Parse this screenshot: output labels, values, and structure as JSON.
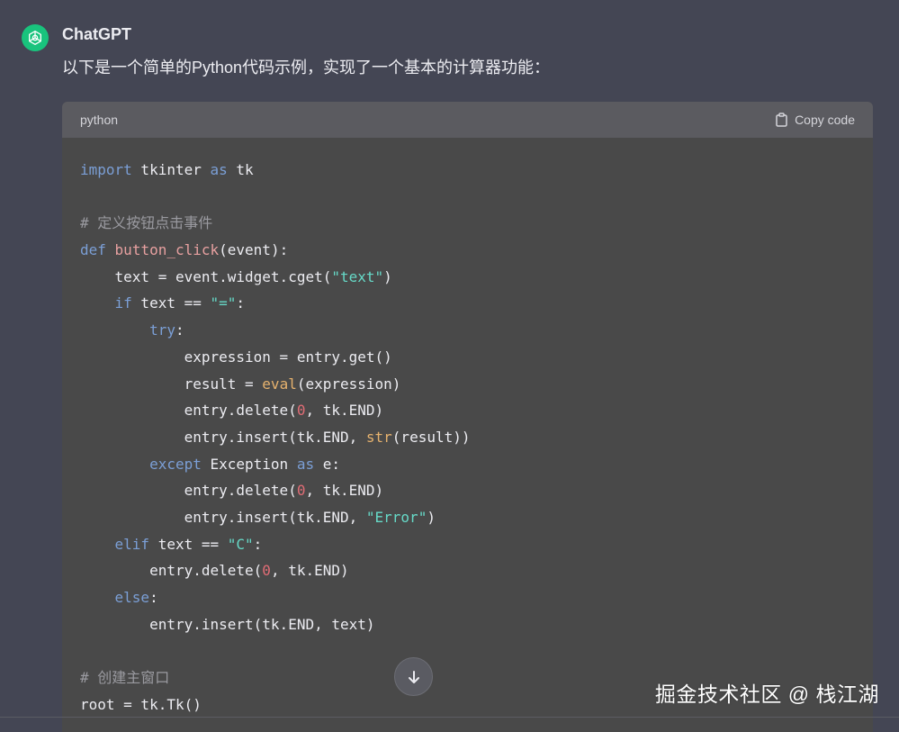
{
  "message": {
    "author": "ChatGPT",
    "intro": "以下是一个简单的Python代码示例，实现了一个基本的计算器功能："
  },
  "code_block": {
    "language": "python",
    "copy_label": "Copy code",
    "lines": [
      [
        {
          "t": "import",
          "c": "kw"
        },
        {
          "t": " tkinter "
        },
        {
          "t": "as",
          "c": "kw"
        },
        {
          "t": " tk"
        }
      ],
      [],
      [
        {
          "t": "# 定义按钮点击事件",
          "c": "cm"
        }
      ],
      [
        {
          "t": "def",
          "c": "kw"
        },
        {
          "t": " "
        },
        {
          "t": "button_click",
          "c": "fn"
        },
        {
          "t": "(event):"
        }
      ],
      [
        {
          "t": "    text = event.widget.cget("
        },
        {
          "t": "\"text\"",
          "c": "str"
        },
        {
          "t": ")"
        }
      ],
      [
        {
          "t": "    "
        },
        {
          "t": "if",
          "c": "kw"
        },
        {
          "t": " text == "
        },
        {
          "t": "\"=\"",
          "c": "str"
        },
        {
          "t": ":"
        }
      ],
      [
        {
          "t": "        "
        },
        {
          "t": "try",
          "c": "kw"
        },
        {
          "t": ":"
        }
      ],
      [
        {
          "t": "            expression = entry.get()"
        }
      ],
      [
        {
          "t": "            result = "
        },
        {
          "t": "eval",
          "c": "bi"
        },
        {
          "t": "(expression)"
        }
      ],
      [
        {
          "t": "            entry.delete("
        },
        {
          "t": "0",
          "c": "num"
        },
        {
          "t": ", tk.END)"
        }
      ],
      [
        {
          "t": "            entry.insert(tk.END, "
        },
        {
          "t": "str",
          "c": "bi"
        },
        {
          "t": "(result))"
        }
      ],
      [
        {
          "t": "        "
        },
        {
          "t": "except",
          "c": "kw"
        },
        {
          "t": " Exception "
        },
        {
          "t": "as",
          "c": "kw"
        },
        {
          "t": " e:"
        }
      ],
      [
        {
          "t": "            entry.delete("
        },
        {
          "t": "0",
          "c": "num"
        },
        {
          "t": ", tk.END)"
        }
      ],
      [
        {
          "t": "            entry.insert(tk.END, "
        },
        {
          "t": "\"Error\"",
          "c": "str"
        },
        {
          "t": ")"
        }
      ],
      [
        {
          "t": "    "
        },
        {
          "t": "elif",
          "c": "kw"
        },
        {
          "t": " text == "
        },
        {
          "t": "\"C\"",
          "c": "str"
        },
        {
          "t": ":"
        }
      ],
      [
        {
          "t": "        entry.delete("
        },
        {
          "t": "0",
          "c": "num"
        },
        {
          "t": ", tk.END)"
        }
      ],
      [
        {
          "t": "    "
        },
        {
          "t": "else",
          "c": "kw"
        },
        {
          "t": ":"
        }
      ],
      [
        {
          "t": "        entry.insert(tk.END, text)"
        }
      ],
      [],
      [
        {
          "t": "# 创建主窗口",
          "c": "cm"
        }
      ],
      [
        {
          "t": "root = tk.Tk()"
        }
      ]
    ]
  },
  "scroll_button": {
    "icon": "arrow-down-icon"
  },
  "watermark": "掘金技术社区 @ 栈江湖",
  "colors": {
    "background": "#444654",
    "code_bg": "#494949",
    "code_header_bg": "#5b5b60",
    "avatar": "#19c37d",
    "keyword": "#7b9fd6",
    "function": "#e7a0a0",
    "string": "#66d9c7",
    "number": "#e06c75",
    "builtin": "#e6b26e",
    "comment": "#9a9aa0"
  }
}
